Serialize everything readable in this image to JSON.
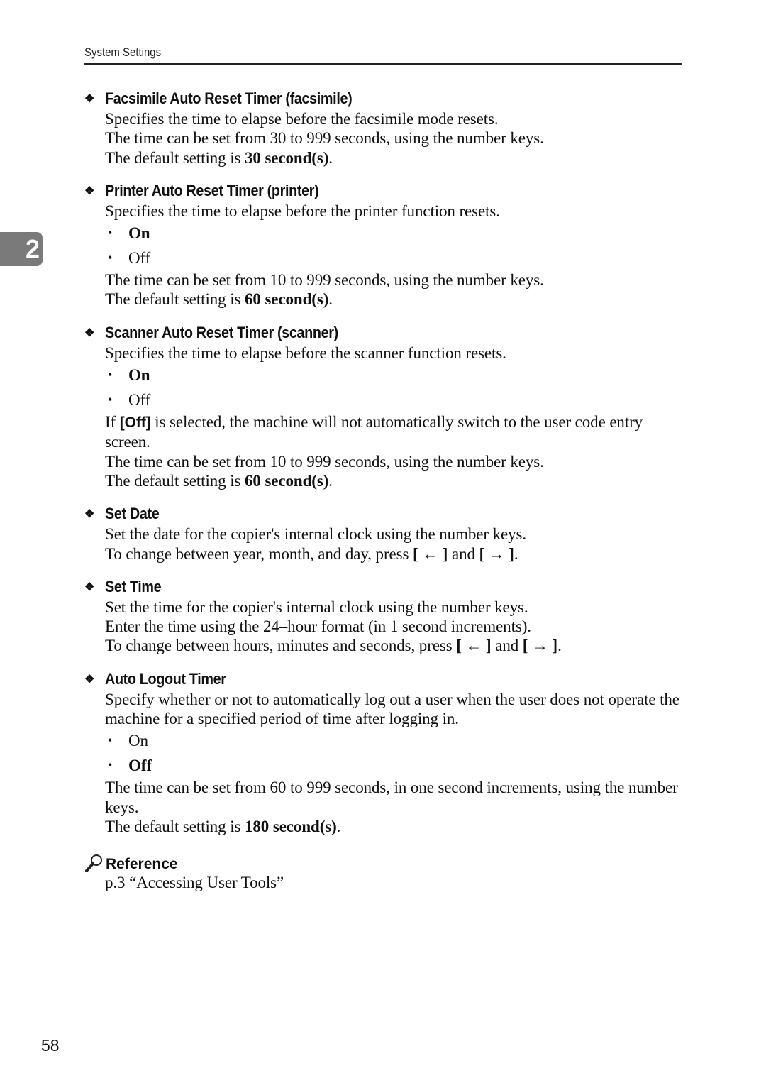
{
  "header": {
    "running_title": "System Settings"
  },
  "chapter_tab": {
    "number": "2"
  },
  "sections": [
    {
      "title": "Facsimile Auto Reset Timer (facsimile)",
      "description": "Specifies the time to elapse before the facsimile mode resets.",
      "range_text": "The time can be set from 30 to 999 seconds, using the number keys.",
      "default_prefix": "The default setting is ",
      "default_value": "30 second(s)",
      "default_suffix": "."
    },
    {
      "title": "Printer Auto Reset Timer (printer)",
      "description": "Specifies the time to elapse before the printer function resets.",
      "options": [
        {
          "label": "On",
          "default": true
        },
        {
          "label": "Off",
          "default": false
        }
      ],
      "range_text": "The time can be set from 10 to 999 seconds, using the number keys.",
      "default_prefix": "The default setting is ",
      "default_value": "60 second(s)",
      "default_suffix": "."
    },
    {
      "title": "Scanner Auto Reset Timer (scanner)",
      "description": "Specifies the time to elapse before the scanner function resets.",
      "options": [
        {
          "label": "On",
          "default": true
        },
        {
          "label": "Off",
          "default": false
        }
      ],
      "note_prefix": "If ",
      "note_key": "[Off]",
      "note_suffix": " is selected, the machine will not automatically switch to the user code entry screen.",
      "range_text": "The time can be set from 10 to 999 seconds, using the number keys.",
      "default_prefix": "The default setting is ",
      "default_value": "60 second(s)",
      "default_suffix": "."
    },
    {
      "title": "Set Date",
      "description": "Set the date for the copier's internal clock using the number keys.",
      "nav_prefix": "To change between year, month, and day, press ",
      "key_left": "[ ← ]",
      "nav_and": " and ",
      "key_right": "[ → ]",
      "nav_suffix": "."
    },
    {
      "title": "Set Time",
      "description": "Set the time for the copier's internal clock using the number keys.",
      "format_text": "Enter the time using the 24–hour format (in 1 second increments).",
      "nav_prefix": "To change between hours, minutes and seconds, press ",
      "key_left": "[ ← ]",
      "nav_and": " and ",
      "key_right": "[ → ]",
      "nav_suffix": "."
    },
    {
      "title": "Auto Logout Timer",
      "description": "Specify whether or not to automatically log out a user when the user does not operate the machine for a specified period of time after logging in.",
      "options": [
        {
          "label": "On",
          "default": false
        },
        {
          "label": "Off",
          "default": true
        }
      ],
      "range_text": "The time can be set from 60 to 999 seconds, in one second increments, using the number keys.",
      "default_prefix": "The default setting is ",
      "default_value": "180 second(s)",
      "default_suffix": "."
    }
  ],
  "reference": {
    "title": "Reference",
    "icon": "magnifier-icon",
    "link_text": "p.3 “Accessing User Tools”"
  },
  "bullet_glyph": "❖",
  "list_bullet": "•",
  "page_number": "58"
}
